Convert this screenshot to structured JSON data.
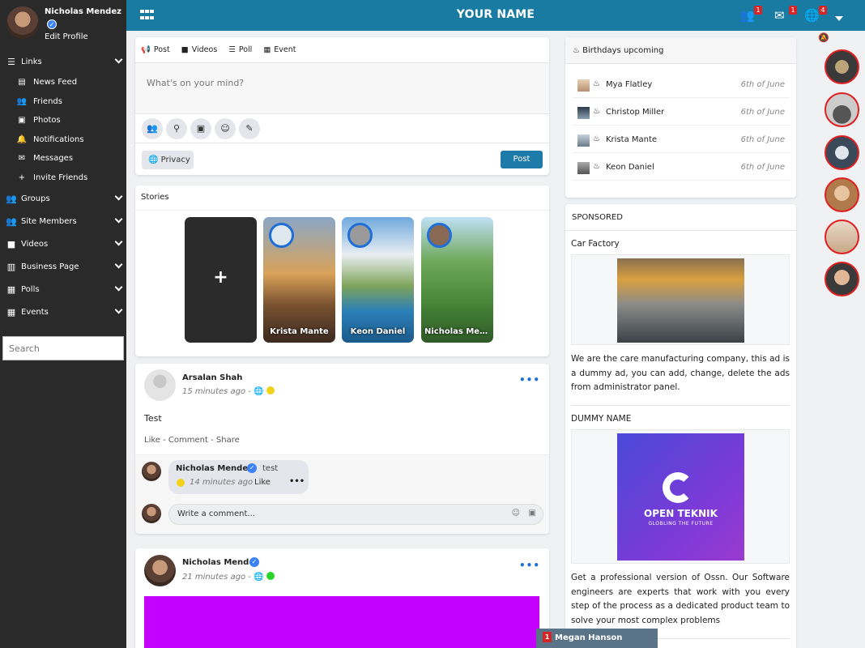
{
  "colors": {
    "topbar": "#1a7ba2",
    "sidebar": "#2a2a2a",
    "accent": "#1e7aa8",
    "badge": "#d42626",
    "verified": "#3b82f6"
  },
  "user": {
    "name": "Nicholas Mendez",
    "edit_profile": "Edit Profile",
    "verified_icon": "check-badge-icon"
  },
  "topbar": {
    "title": "YOUR NAME",
    "friends_badge": "1",
    "messages_badge": "1",
    "notifications_badge": "4"
  },
  "sidebar": {
    "links_label": "Links",
    "links": [
      {
        "label": "News Feed",
        "icon": "news-icon"
      },
      {
        "label": "Friends",
        "icon": "users-icon"
      },
      {
        "label": "Photos",
        "icon": "photo-icon"
      },
      {
        "label": "Notifications",
        "icon": "bell-icon"
      },
      {
        "label": "Messages",
        "icon": "envelope-icon"
      },
      {
        "label": "Invite Friends",
        "icon": "user-plus-icon"
      }
    ],
    "sections": [
      {
        "label": "Groups",
        "icon": "users-icon"
      },
      {
        "label": "Site Members",
        "icon": "users-icon"
      },
      {
        "label": "Videos",
        "icon": "video-icon"
      },
      {
        "label": "Business Page",
        "icon": "building-icon"
      },
      {
        "label": "Polls",
        "icon": "bar-chart-icon"
      },
      {
        "label": "Events",
        "icon": "calendar-icon"
      }
    ],
    "search_placeholder": "Search"
  },
  "composer": {
    "tabs": {
      "post": "Post",
      "videos": "Videos",
      "poll": "Poll",
      "event": "Event"
    },
    "placeholder": "What's on your mind?",
    "privacy": "Privacy",
    "post_button": "Post"
  },
  "stories": {
    "title": "Stories",
    "add_symbol": "+",
    "items": [
      {
        "name": "Krista Mante"
      },
      {
        "name": "Keon Daniel"
      },
      {
        "name": "Nicholas Men..."
      }
    ]
  },
  "post1": {
    "author": "Arsalan Shah",
    "time": "15 minutes ago",
    "dash": "-",
    "text": "Test",
    "actions": {
      "like": "Like",
      "comment": "Comment",
      "share": "Share",
      "sep": "-"
    },
    "more": "•••",
    "comment": {
      "author": "Nicholas Mendez",
      "text": "test",
      "time": "14 minutes ago",
      "like": "Like",
      "more": "•••"
    },
    "comment_placeholder": "Write a comment..."
  },
  "post2": {
    "author": "Nicholas Mendez",
    "time": "21 minutes ago",
    "dash": "-",
    "more": "•••",
    "image_color": "#c400ff"
  },
  "birthdays": {
    "title": "Birthdays upcoming",
    "items": [
      {
        "name": "Mya Flatley",
        "date": "6th of June"
      },
      {
        "name": "Christop Miller",
        "date": "6th of June"
      },
      {
        "name": "Krista Mante",
        "date": "6th of June"
      },
      {
        "name": "Keon Daniel",
        "date": "6th of June"
      }
    ]
  },
  "sponsored": {
    "title": "SPONSORED",
    "ads": [
      {
        "title": "Car Factory",
        "text": "We are the care manufacturing company, this ad is a dummy ad, you can add, change, delete the ads from administrator panel."
      },
      {
        "title": "DUMMY NAME",
        "brand": "OPEN TEKNIK",
        "tagline": "GLOBLING THE FUTURE",
        "text": "Get a professional version of Ossn. Our Software engineers are experts that work with you every step of the process as a dedicated product team to solve your most complex problems"
      }
    ]
  },
  "chat": {
    "badge": "1",
    "name": "Megan Hanson"
  }
}
